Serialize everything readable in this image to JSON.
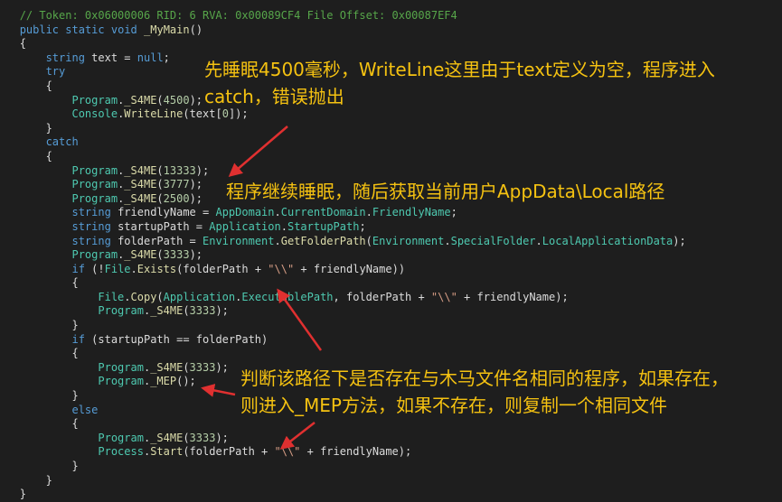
{
  "code": {
    "comment": "// Token: 0x06000006 RID: 6 RVA: 0x00089CF4 File Offset: 0x00087EF4",
    "sig_public": "public",
    "sig_static": "static",
    "sig_void": "void",
    "sig_name": "_MyMain",
    "kw_string": "string",
    "kw_null": "null",
    "kw_try": "try",
    "kw_catch": "catch",
    "kw_if": "if",
    "kw_else": "else",
    "cls_program": "Program",
    "cls_console": "Console",
    "cls_appdomain": "AppDomain",
    "cls_application": "Application",
    "cls_environment": "Environment",
    "cls_file": "File",
    "cls_process": "Process",
    "m_s4me": "_S4ME",
    "m_writeline": "WriteLine",
    "m_currentdomain": "CurrentDomain",
    "m_friendlyname": "FriendlyName",
    "m_startuppath": "StartupPath",
    "m_getfolderpath": "GetFolderPath",
    "m_specialfolder": "SpecialFolder",
    "m_localappdata": "LocalApplicationData",
    "m_exists": "Exists",
    "m_copy": "Copy",
    "m_executablepath": "ExecutablePath",
    "m_mep": "_MEP",
    "m_start": "Start",
    "v_text": "text",
    "v_friendlyname": "friendlyName",
    "v_startuppath": "startupPath",
    "v_folderpath": "folderPath",
    "n_4500": "4500",
    "n_0": "0",
    "n_13333": "13333",
    "n_3777": "3777",
    "n_2500": "2500",
    "n_3333": "3333",
    "s_backslash": "\"\\\\\""
  },
  "annotations": {
    "a1_line1": "先睡眠4500毫秒，WriteLine这里由于text定义为空，程序进入",
    "a1_line2": "catch，错误抛出",
    "a2": "程序继续睡眠，随后获取当前用户AppData\\Local路径",
    "a3_line1": "判断该路径下是否存在与木马文件名相同的程序，如果存在，",
    "a3_line2": "则进入_MEP方法，如果不存在，则复制一个相同文件"
  },
  "colors": {
    "annotation": "#f5c211",
    "arrow": "#e03030",
    "background": "#1e1e1e"
  }
}
